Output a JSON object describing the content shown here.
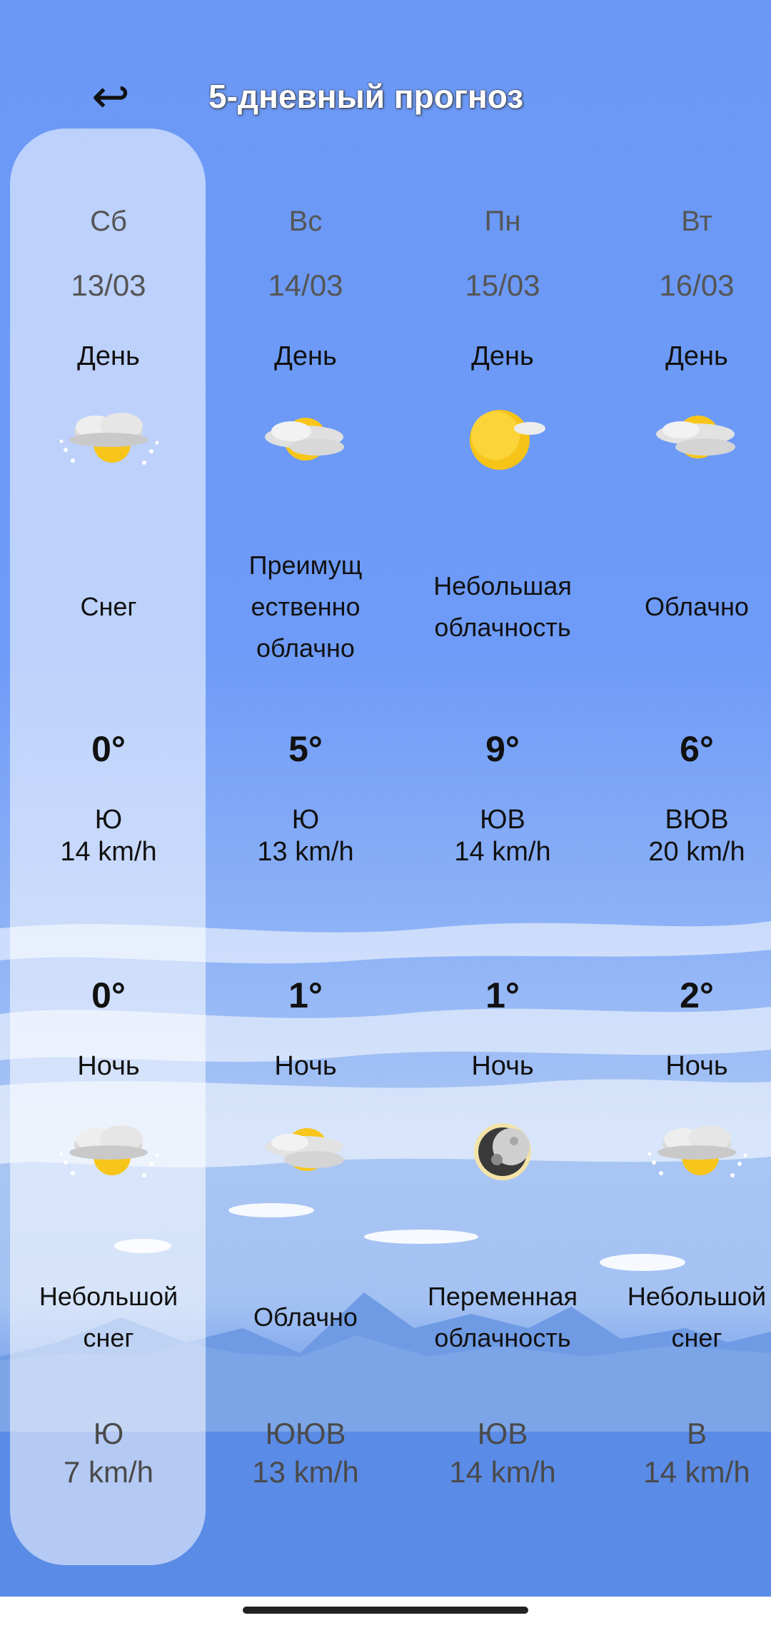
{
  "header": {
    "back_icon": "↩",
    "title": "5-дневный прогноз"
  },
  "days": [
    {
      "dow": "Сб",
      "date": "13/03",
      "day_label": "День",
      "day_icon": "snow-cloud-icon",
      "day_cond": "Снег",
      "day_temp": "0°",
      "day_wind_dir": "Ю",
      "day_wind_speed": "14 km/h",
      "night_temp": "0°",
      "night_label": "Ночь",
      "night_icon": "snow-cloud-icon",
      "night_cond": "Небольшой\nснег",
      "night_wind_dir": "Ю",
      "night_wind_speed": "7 km/h"
    },
    {
      "dow": "Вс",
      "date": "14/03",
      "day_label": "День",
      "day_icon": "mostly-cloudy-icon",
      "day_cond": "Преимущ\nественно\nоблачно",
      "day_temp": "5°",
      "day_wind_dir": "Ю",
      "day_wind_speed": "13 km/h",
      "night_temp": "1°",
      "night_label": "Ночь",
      "night_icon": "cloudy-icon",
      "night_cond": "Облачно",
      "night_wind_dir": "ЮЮВ",
      "night_wind_speed": "13 km/h"
    },
    {
      "dow": "Пн",
      "date": "15/03",
      "day_label": "День",
      "day_icon": "sunny-icon",
      "day_cond": "Небольшая\nоблачность",
      "day_temp": "9°",
      "day_wind_dir": "ЮВ",
      "day_wind_speed": "14 km/h",
      "night_temp": "1°",
      "night_label": "Ночь",
      "night_icon": "moon-icon",
      "night_cond": "Переменная\nоблачность",
      "night_wind_dir": "ЮВ",
      "night_wind_speed": "14 km/h"
    },
    {
      "dow": "Вт",
      "date": "16/03",
      "day_label": "День",
      "day_icon": "cloudy-icon",
      "day_cond": "Облачно",
      "day_temp": "6°",
      "day_wind_dir": "ВЮВ",
      "day_wind_speed": "20 km/h",
      "night_temp": "2°",
      "night_label": "Ночь",
      "night_icon": "snow-cloud-icon",
      "night_cond": "Небольшой\nснег",
      "night_wind_dir": "В",
      "night_wind_speed": "14 km/h"
    }
  ]
}
